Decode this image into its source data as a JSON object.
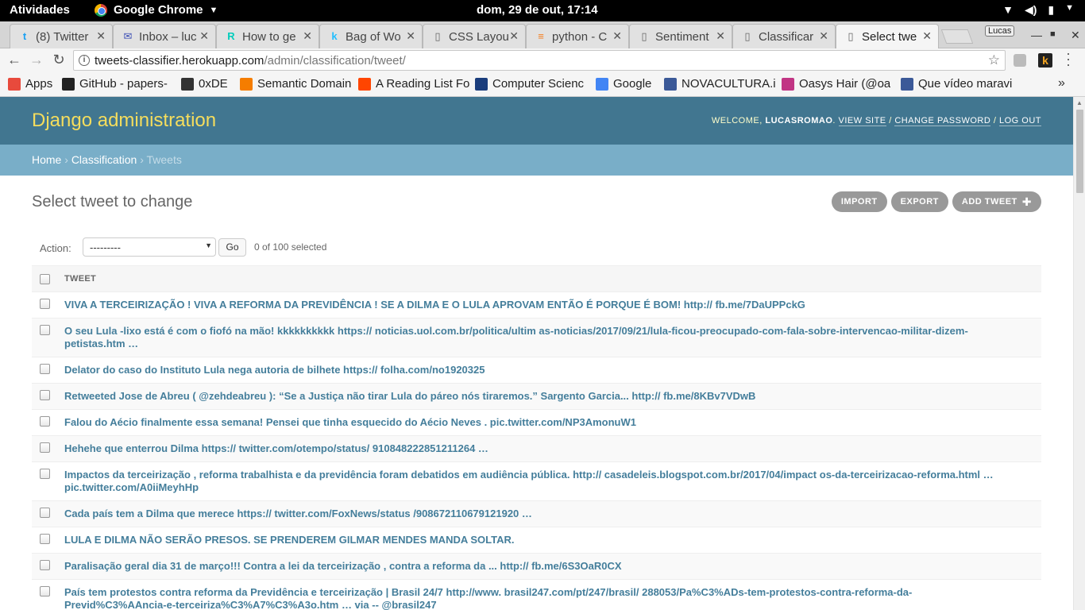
{
  "system": {
    "activities": "Atividades",
    "app_name": "Google Chrome",
    "clock": "dom, 29 de out, 17:14"
  },
  "tabs": [
    {
      "title": "(8) Twitter",
      "icon": "twitter-icon",
      "color": "#1da1f2",
      "glyph": "t"
    },
    {
      "title": "Inbox – luc",
      "icon": "inbox-icon",
      "color": "#3f51b5",
      "glyph": "✉"
    },
    {
      "title": "How to ge",
      "icon": "rg-icon",
      "color": "#00ccbb",
      "glyph": "R"
    },
    {
      "title": "Bag of Wo",
      "icon": "kaggle-icon",
      "color": "#20beff",
      "glyph": "k"
    },
    {
      "title": "CSS Layou",
      "icon": "page-icon",
      "color": "#666666",
      "glyph": "▯"
    },
    {
      "title": "python - C",
      "icon": "stackoverflow-icon",
      "color": "#f48024",
      "glyph": "≡"
    },
    {
      "title": "Sentiment",
      "icon": "page-icon",
      "color": "#666666",
      "glyph": "▯"
    },
    {
      "title": "Classificar",
      "icon": "page-icon",
      "color": "#666666",
      "glyph": "▯"
    },
    {
      "title": "Select twe",
      "icon": "page-icon",
      "color": "#666666",
      "glyph": "▯"
    }
  ],
  "profile": "Lucas",
  "omnibox": {
    "host": "tweets-classifier.herokuapp.com",
    "path": "/admin/classification/tweet/"
  },
  "bookmarks": [
    {
      "label": "Apps",
      "icon": "apps-icon",
      "color": "#e84a3c"
    },
    {
      "label": "GitHub - papers-",
      "icon": "github-icon",
      "color": "#222222"
    },
    {
      "label": "0xDE",
      "icon": "person-icon",
      "color": "#333333"
    },
    {
      "label": "Semantic Domain",
      "icon": "blogger-icon",
      "color": "#f57d00"
    },
    {
      "label": "A Reading List Fo",
      "icon": "reddit-icon",
      "color": "#ff4500"
    },
    {
      "label": "Computer Scienc",
      "icon": "shield-icon",
      "color": "#1a3d7c"
    },
    {
      "label": "Google",
      "icon": "google-icon",
      "color": "#4285f4"
    },
    {
      "label": "NOVACULTURA.i",
      "icon": "facebook-icon",
      "color": "#3b5998"
    },
    {
      "label": "Oasys Hair (@oa",
      "icon": "instagram-icon",
      "color": "#c13584"
    },
    {
      "label": "Que vídeo maravi",
      "icon": "facebook-icon",
      "color": "#3b5998"
    }
  ],
  "admin": {
    "branding": "Django administration",
    "welcome": "WELCOME,",
    "username": "LUCASROMAO",
    "view_site": "VIEW SITE",
    "change_password": "CHANGE PASSWORD",
    "log_out": "LOG OUT",
    "breadcrumb_home": "Home",
    "breadcrumb_app": "Classification",
    "breadcrumb_current": "Tweets",
    "title": "Select tweet to change",
    "import": "IMPORT",
    "export": "EXPORT",
    "add": "ADD TWEET",
    "action_label": "Action:",
    "action_value": "---------",
    "go": "Go",
    "selected_count": "0 of 100 selected",
    "column_header": "TWEET"
  },
  "tweets": [
    "VIVA A TERCEIRIZAÇÃO ! VIVA A REFORMA DA PREVIDÊNCIA ! SE A DILMA E O LULA APROVAM ENTÃO É PORQUE É BOM! http:// fb.me/7DaUPPckG",
    "O seu Lula -lixo está é com o fiofó na mão! kkkkkkkkkk https:// noticias.uol.com.br/politica/ultim as-noticias/2017/09/21/lula-ficou-preocupado-com-fala-sobre-intervencao-militar-dizem-petistas.htm …",
    "Delator do caso do Instituto Lula nega autoria de bilhete https:// folha.com/no1920325",
    "Retweeted Jose de Abreu ( @zehdeabreu ): “Se a Justiça não tirar Lula do páreo nós tiraremos.” Sargento Garcia... http:// fb.me/8KBv7VDwB",
    "Falou do Aécio finalmente essa semana! Pensei que tinha esquecido do Aécio Neves . pic.twitter.com/NP3AmonuW1",
    "Hehehe que enterrou Dilma https:// twitter.com/otempo/status/ 910848222851211264 …",
    "Impactos da terceirização , reforma trabalhista e da previdência foram debatidos em audiência pública. http:// casadeleis.blogspot.com.br/2017/04/impact os-da-terceirizacao-reforma.html … pic.twitter.com/A0iiMeyhHp",
    "Cada país tem a Dilma que merece https:// twitter.com/FoxNews/status /908672110679121920 …",
    "LULA E DILMA NÃO SERÃO PRESOS. SE PRENDEREM GILMAR MENDES MANDA SOLTAR.",
    "Paralisação geral dia 31 de março!!! Contra a lei da terceirização , contra a reforma da ... http:// fb.me/6S3OaR0CX",
    "País tem protestos contra reforma da Previdência e terceirização | Brasil 24/7 http://www. brasil247.com/pt/247/brasil/ 288053/Pa%C3%ADs-tem-protestos-contra-reforma-da-Previd%C3%AAncia-e-terceiriza%C3%A7%C3%A3o.htm … via -- @brasil247"
  ]
}
